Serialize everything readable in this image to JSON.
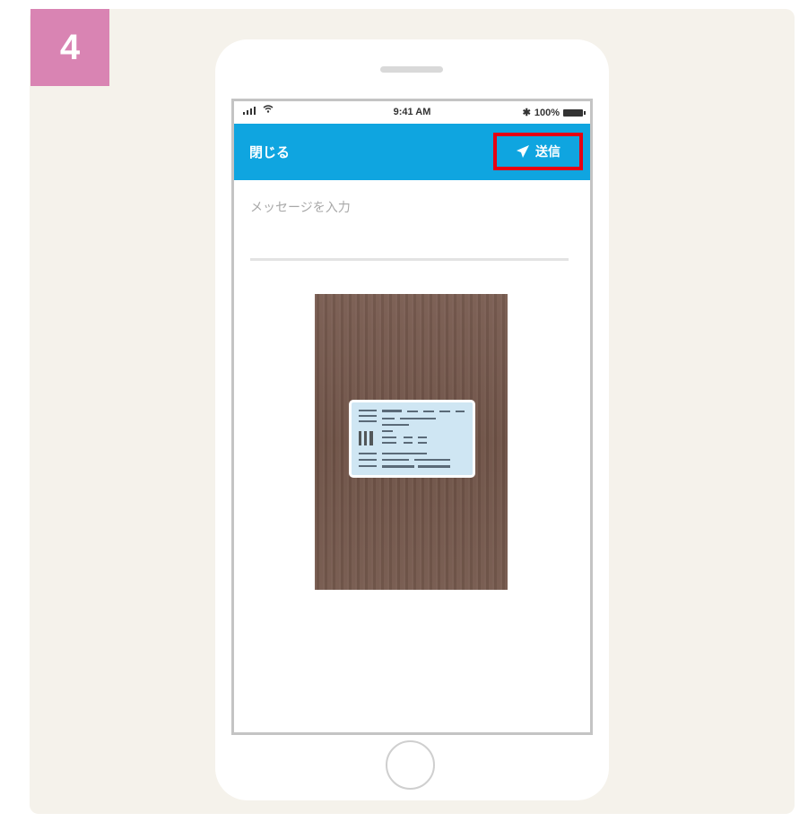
{
  "step": {
    "number": "4"
  },
  "status_bar": {
    "time": "9:41 AM",
    "battery": "100%"
  },
  "nav": {
    "close_label": "閉じる",
    "send_label": "送信",
    "send_icon": "paper-plane-icon",
    "highlight_color": "#e60012",
    "bar_color": "#0fa5e0"
  },
  "compose": {
    "placeholder": "メッセージを入力"
  },
  "attachment": {
    "description_icon": "id-card-photo"
  },
  "colors": {
    "badge": "#d984b3",
    "panel": "#f5f2eb"
  }
}
